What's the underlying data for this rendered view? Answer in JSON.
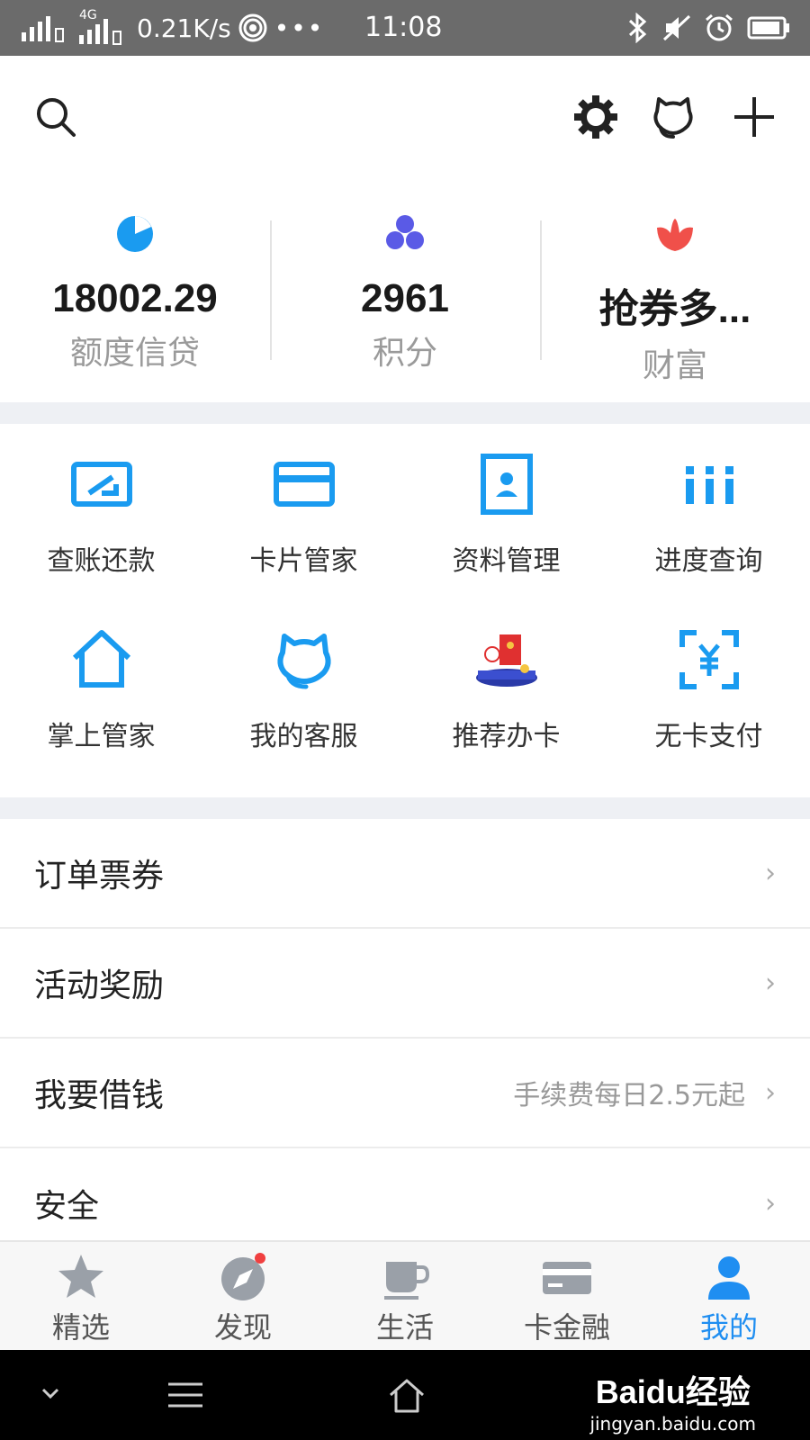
{
  "status_bar": {
    "network_speed": "0.21K/s",
    "network_type": "4G",
    "time": "11:08",
    "dots": "•••"
  },
  "stats": [
    {
      "value": "18002.29",
      "label": "额度信贷",
      "icon": "pie-icon",
      "color": "#1a9bf0"
    },
    {
      "value": "2961",
      "label": "积分",
      "icon": "dots-cluster-icon",
      "color": "#5a5ae6"
    },
    {
      "value": "抢券多...",
      "label": "财富",
      "icon": "flower-icon",
      "color": "#f0504a"
    }
  ],
  "grid": [
    {
      "label": "查账还款",
      "icon": "bill-repay-icon"
    },
    {
      "label": "卡片管家",
      "icon": "card-icon"
    },
    {
      "label": "资料管理",
      "icon": "profile-icon"
    },
    {
      "label": "进度查询",
      "icon": "progress-icon"
    },
    {
      "label": "掌上管家",
      "icon": "home-icon"
    },
    {
      "label": "我的客服",
      "icon": "service-icon"
    },
    {
      "label": "推荐办卡",
      "icon": "recommend-card-icon"
    },
    {
      "label": "无卡支付",
      "icon": "scan-pay-icon"
    }
  ],
  "list": [
    {
      "title": "订单票券",
      "extra": ""
    },
    {
      "title": "活动奖励",
      "extra": ""
    },
    {
      "title": "我要借钱",
      "extra": "手续费每日2.5元起"
    },
    {
      "title": "安全",
      "extra": ""
    }
  ],
  "chevron": "›",
  "tabs": [
    {
      "label": "精选",
      "icon": "star-icon",
      "active": false
    },
    {
      "label": "发现",
      "icon": "compass-icon",
      "active": false
    },
    {
      "label": "生活",
      "icon": "cup-icon",
      "active": false
    },
    {
      "label": "卡金融",
      "icon": "card-icon",
      "active": false
    },
    {
      "label": "我的",
      "icon": "person-icon",
      "active": true
    }
  ],
  "colors": {
    "accent": "#1f8ef1",
    "status_bar": "#6b6b6b",
    "section_gap": "#eef0f4"
  },
  "watermark": {
    "logo": "Baidu经验",
    "url": "jingyan.baidu.com"
  }
}
